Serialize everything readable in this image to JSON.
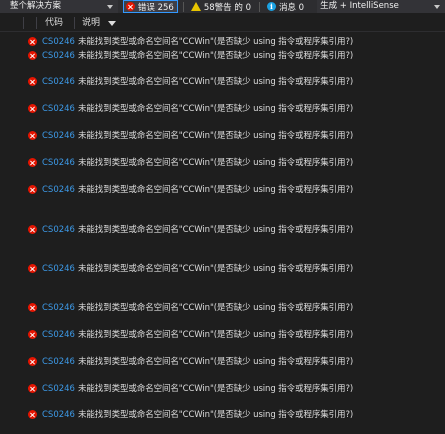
{
  "toolbar": {
    "scope": "整个解决方案",
    "errors_label": "错误 256",
    "warnings_label": "58警告 的 0",
    "messages_label": "消息 0",
    "build_filter": "生成 + IntelliSense"
  },
  "columns": {
    "code": "代码",
    "description": "说明"
  },
  "rows": [
    {
      "code": "CS0246",
      "message": "未能找到类型或命名空间名\"CCWin\"(是否缺少 using 指令或程序集引用?)"
    },
    {
      "code": "CS0246",
      "message": "未能找到类型或命名空间名\"CCWin\"(是否缺少 using 指令或程序集引用?)"
    },
    {
      "code": "CS0246",
      "message": "未能找到类型或命名空间名\"CCWin\"(是否缺少 using 指令或程序集引用?)"
    },
    {
      "code": "CS0246",
      "message": "未能找到类型或命名空间名\"CCWin\"(是否缺少 using 指令或程序集引用?)"
    },
    {
      "code": "CS0246",
      "message": "未能找到类型或命名空间名\"CCWin\"(是否缺少 using 指令或程序集引用?)"
    },
    {
      "code": "CS0246",
      "message": "未能找到类型或命名空间名\"CCWin\"(是否缺少 using 指令或程序集引用?)"
    },
    {
      "code": "CS0246",
      "message": "未能找到类型或命名空间名\"CCWin\"(是否缺少 using 指令或程序集引用?)"
    },
    {
      "code": "CS0246",
      "message": "未能找到类型或命名空间名\"CCWin\"(是否缺少 using 指令或程序集引用?)"
    },
    {
      "code": "CS0246",
      "message": "未能找到类型或命名空间名\"CCWin\"(是否缺少 using 指令或程序集引用?)"
    },
    {
      "code": "CS0246",
      "message": "未能找到类型或命名空间名\"CCWin\"(是否缺少 using 指令或程序集引用?)"
    },
    {
      "code": "CS0246",
      "message": "未能找到类型或命名空间名\"CCWin\"(是否缺少 using 指令或程序集引用?)"
    },
    {
      "code": "CS0246",
      "message": "未能找到类型或命名空间名\"CCWin\"(是否缺少 using 指令或程序集引用?)"
    },
    {
      "code": "CS0246",
      "message": "未能找到类型或命名空间名\"CCWin\"(是否缺少 using 指令或程序集引用?)"
    },
    {
      "code": "CS0246",
      "message": "未能找到类型或命名空间名\"CCWin\"(是否缺少 using 指令或程序集引用?)"
    },
    {
      "code": "CS0246",
      "message": "未能找到类型或命名空间名\"CCWin\"(是否缺少 using 指令或程序集引用?)"
    }
  ],
  "colors": {
    "background": "#1e1e1e",
    "toolbar": "#2d2d30",
    "error_icon": "#e51400",
    "warning_icon": "#e8c500",
    "info_icon": "#1ba1e2",
    "code_link": "#3d9ae8",
    "active_border": "#3399ff"
  },
  "icons": {
    "error": "error-icon",
    "warning": "warning-icon",
    "info": "info-icon",
    "filter": "filter-icon",
    "dropdown": "chevron-down-icon"
  }
}
